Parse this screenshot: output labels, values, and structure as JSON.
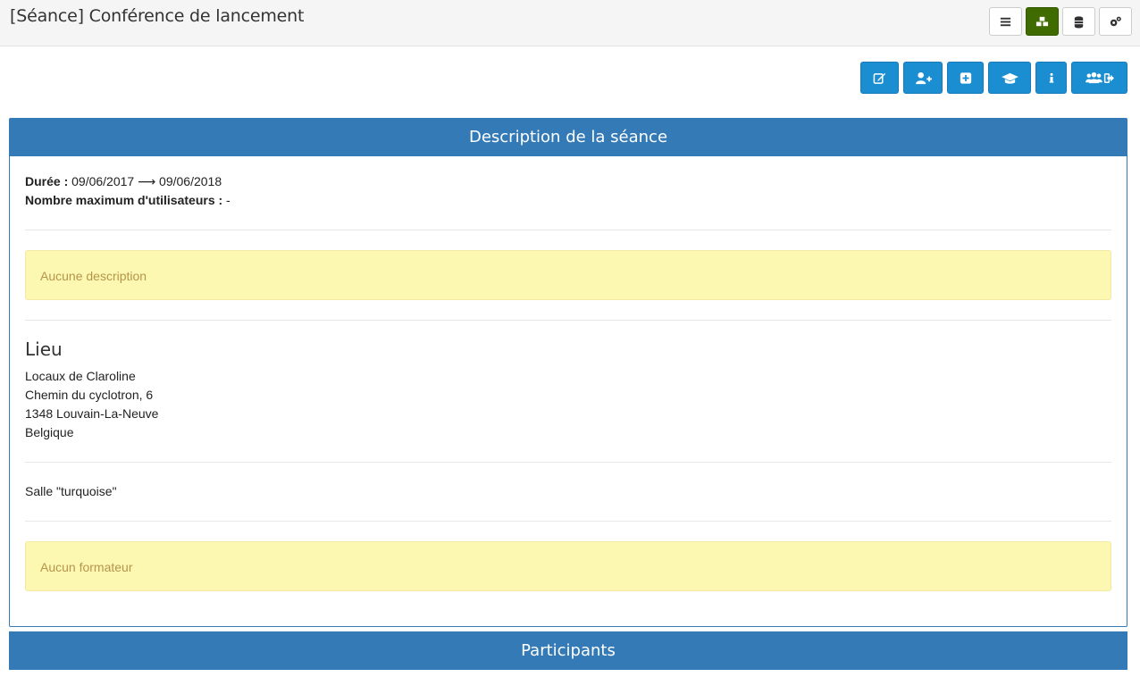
{
  "header": {
    "title": "[Séance] Conférence de lancement",
    "view_buttons": [
      {
        "icon": "list-icon"
      },
      {
        "icon": "cubes-icon",
        "active": true
      },
      {
        "icon": "database-icon"
      },
      {
        "icon": "cogs-icon"
      }
    ]
  },
  "actions": [
    {
      "icon": "edit-icon"
    },
    {
      "icon": "user-plus-icon"
    },
    {
      "icon": "plus-square-icon"
    },
    {
      "icon": "graduation-cap-icon"
    },
    {
      "icon": "info-icon"
    },
    {
      "icon": "users-signout-icon"
    }
  ],
  "description_panel": {
    "heading": "Description de la séance",
    "duration_label": "Durée :",
    "duration_value": "09/06/2017 ⟶ 09/06/2018",
    "max_users_label": "Nombre maximum d'utilisateurs :",
    "max_users_value": "-",
    "no_description": "Aucune description",
    "location_title": "Lieu",
    "address": {
      "line1": "Locaux de Claroline",
      "line2": "Chemin du cyclotron, 6",
      "line3": "1348 Louvain-La-Neuve",
      "line4": "Belgique"
    },
    "room": "Salle \"turquoise\"",
    "no_trainer": "Aucun formateur"
  },
  "participants_panel": {
    "heading": "Participants"
  },
  "colors": {
    "primary": "#337ab7",
    "action_button": "#1b8ed2",
    "active_view": "#3f6b00",
    "warning_bg": "#fcf8b2",
    "warning_text": "#b5954a"
  }
}
